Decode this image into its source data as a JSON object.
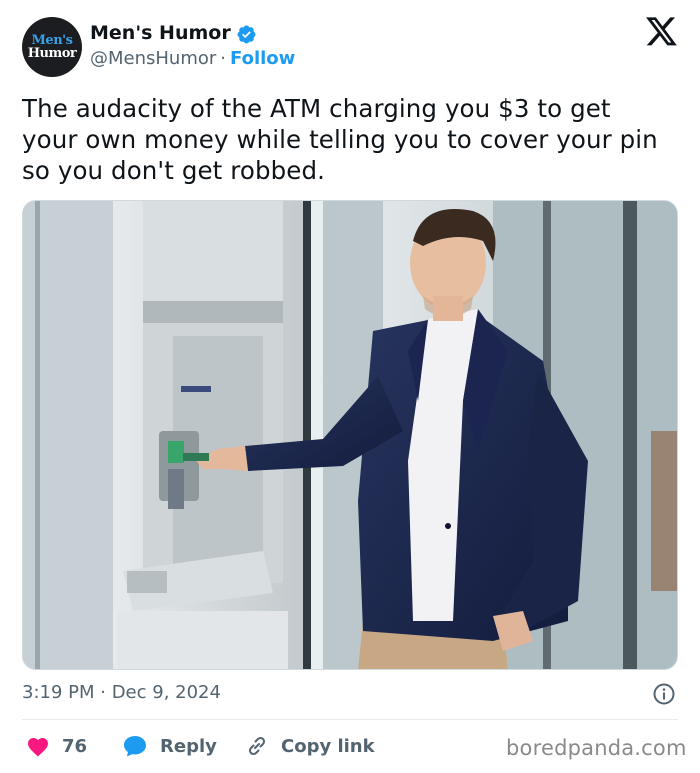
{
  "author": {
    "avatar_line1": "Men's",
    "avatar_line2": "Humor",
    "name": "Men's Humor",
    "handle": "@MensHumor",
    "separator": "·",
    "follow_label": "Follow"
  },
  "tweet": {
    "text": "The audacity of the ATM charging you $3 to get your own money while telling you to cover your pin so you don't get robbed.",
    "timestamp": "3:19 PM · Dec 9, 2024"
  },
  "actions": {
    "like_count": "76",
    "reply_label": "Reply",
    "copy_label": "Copy link"
  },
  "icons": {
    "verified": "verified-badge-icon",
    "logo": "x-logo-icon",
    "info": "info-icon",
    "like": "heart-icon",
    "reply": "reply-bubble-icon",
    "copy": "link-icon"
  },
  "colors": {
    "accent": "#1d9bf0",
    "like": "#f91880",
    "text": "#0f1419",
    "muted": "#536471"
  },
  "watermark": "boredpanda.com"
}
